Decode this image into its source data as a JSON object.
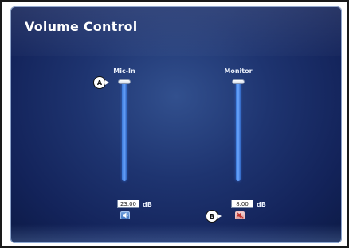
{
  "panel": {
    "title": "Volume Control"
  },
  "channels": [
    {
      "label": "Mic-In",
      "value": "23.00",
      "unit": "dB",
      "level": 1.0,
      "muted": false,
      "mute_icon": "speaker-icon"
    },
    {
      "label": "Monitor",
      "value": "8.00",
      "unit": "dB",
      "level": 1.0,
      "muted": true,
      "mute_icon": "speaker-muted-icon"
    }
  ],
  "callouts": {
    "a": "A",
    "b": "B"
  },
  "colors": {
    "panel_bg": "#1e3470",
    "slider_track": "#4a8cf0",
    "mute_off": "#d89a9a"
  }
}
